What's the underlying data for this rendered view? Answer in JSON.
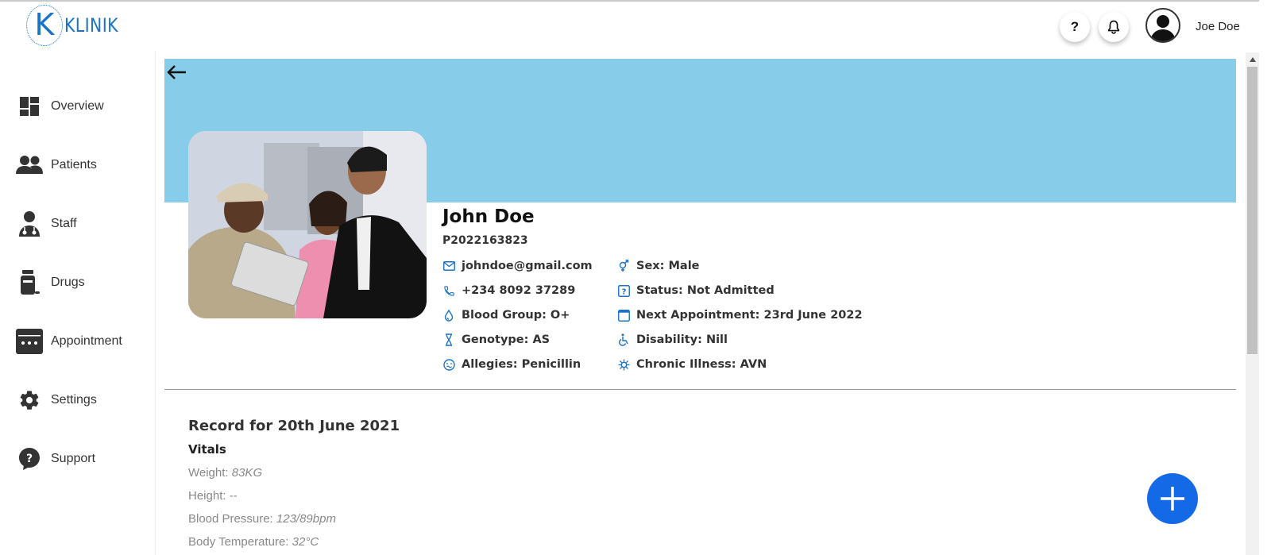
{
  "logo": {
    "letter": "K",
    "text": "KLINIK"
  },
  "header": {
    "help_label": "?",
    "user_name": "Joe Doe"
  },
  "sidebar": {
    "items": [
      {
        "label": "Overview",
        "icon": "dashboard-icon"
      },
      {
        "label": "Patients",
        "icon": "users-icon"
      },
      {
        "label": "Staff",
        "icon": "doctor-icon"
      },
      {
        "label": "Drugs",
        "icon": "pill-bottle-icon"
      },
      {
        "label": "Appointment",
        "icon": "calendar-icon"
      },
      {
        "label": "Settings",
        "icon": "gear-icon"
      },
      {
        "label": "Support",
        "icon": "help-bubble-icon"
      }
    ]
  },
  "banner": {
    "color": "#87cde9"
  },
  "patient": {
    "name": "John Doe",
    "id": "P2022163823",
    "email": "johndoe@gmail.com",
    "phone": "+234 8092 37289",
    "blood_group": "Blood Group: O+",
    "genotype": "Genotype: AS",
    "allergies": "Allegies: Penicillin",
    "sex": "Sex: Male",
    "status": "Status: Not Admitted",
    "next_appointment": "Next Appointment: 23rd June 2022",
    "disability": "Disability: Nill",
    "chronic_illness": "Chronic Illness: AVN"
  },
  "record": {
    "title": "Record for 20th June 2021",
    "vitals_heading": "Vitals",
    "weight_label": "Weight: ",
    "weight_value": "83KG",
    "height_label": "Height: --",
    "bp_label": "Blood Pressure: ",
    "bp_value": "123/89bpm",
    "temp_label": "Body Temperature: ",
    "temp_value": "32°C"
  },
  "colors": {
    "accent": "#1469e6",
    "icon_blue": "#1a73c8",
    "banner": "#87cde9"
  }
}
